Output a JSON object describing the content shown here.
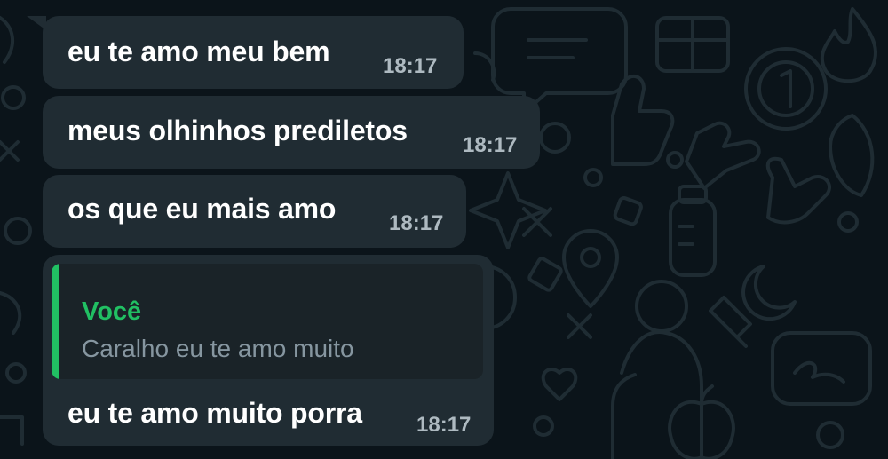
{
  "messages": [
    {
      "text": "eu te amo meu bem",
      "time": "18:17"
    },
    {
      "text": "meus olhinhos prediletos",
      "time": "18:17"
    },
    {
      "text": "os que eu mais amo",
      "time": "18:17"
    },
    {
      "quote": {
        "author": "Você",
        "text": "Caralho eu te amo muito"
      },
      "text": "eu te amo muito porra",
      "time": "18:17"
    }
  ],
  "colors": {
    "background": "#0b141a",
    "bubble": "#202c33",
    "quote_accent": "#21c063",
    "timestamp": "#aebac1"
  }
}
